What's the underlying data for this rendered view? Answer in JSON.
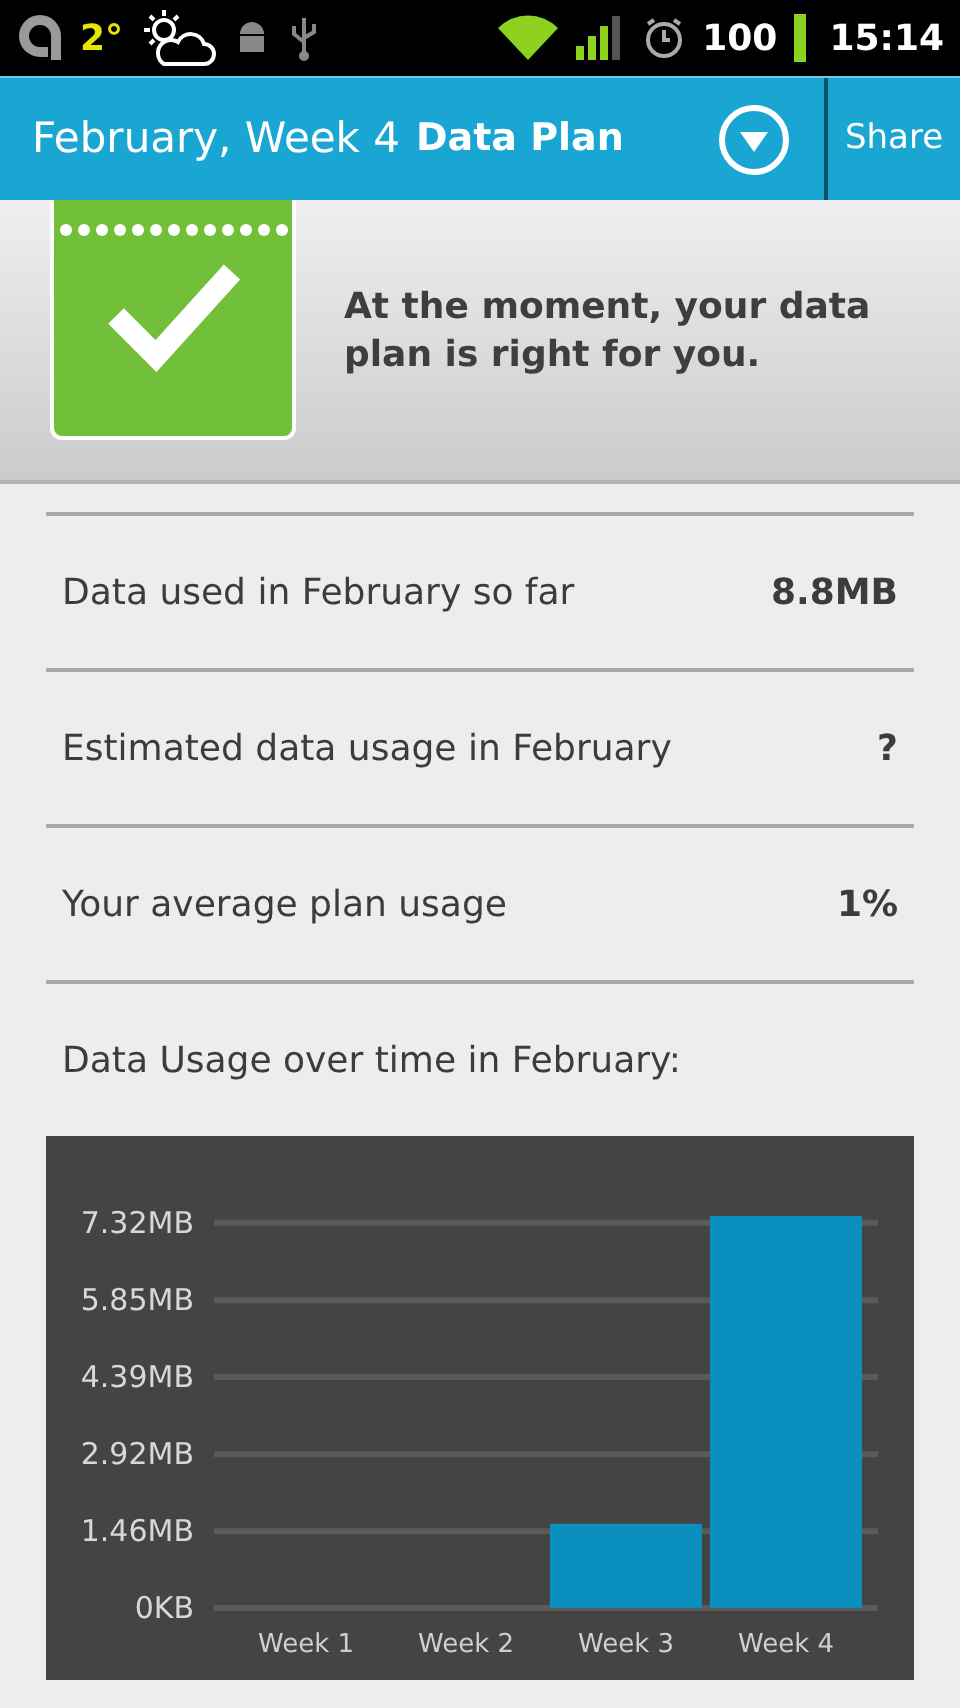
{
  "status_bar": {
    "temperature": "2°",
    "battery": "100",
    "time": "15:14"
  },
  "header": {
    "title": "February, Week 4",
    "subtitle": "Data Plan",
    "share": "Share"
  },
  "banner": {
    "message": "At the moment, your data plan is right for you."
  },
  "stats": [
    {
      "label": "Data used in February so far",
      "value": "8.8MB"
    },
    {
      "label": "Estimated data usage in February",
      "value": "?"
    },
    {
      "label": "Your average plan usage",
      "value": "1%"
    }
  ],
  "chart_section": {
    "title": "Data Usage over time in February:",
    "chart_data": {
      "type": "bar",
      "categories": [
        "Week 1",
        "Week 2",
        "Week 3",
        "Week 4"
      ],
      "series": [
        {
          "color": "#0a8fbf",
          "values": [
            0,
            0,
            1.6,
            7.45
          ]
        }
      ],
      "grid": true,
      "ylim": [
        0,
        7.45
      ],
      "yticks": [
        {
          "value": 0,
          "label": "0KB"
        },
        {
          "value": 1.46,
          "label": "1.46MB"
        },
        {
          "value": 2.92,
          "label": "2.92MB"
        },
        {
          "value": 4.39,
          "label": "4.39MB"
        },
        {
          "value": 5.85,
          "label": "5.85MB"
        },
        {
          "value": 7.32,
          "label": "7.32MB"
        }
      ]
    }
  }
}
